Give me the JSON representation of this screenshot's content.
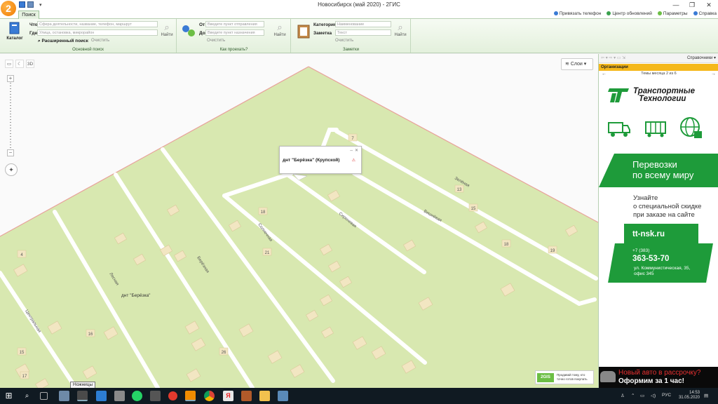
{
  "app": {
    "logo": "2",
    "title": "Новосибирск (май 2020) - 2ГИС",
    "controls": [
      "—",
      "❐",
      "✕"
    ]
  },
  "ribbon": {
    "tab": "Поиск",
    "links": [
      "Привязать телефон",
      "Центр обновлений",
      "Параметры",
      "Справка"
    ],
    "search": {
      "catalog": "Каталог",
      "what_label": "Что",
      "what_placeholder": "Сфера деятельности, название, телефон, маршрут",
      "where_label": "Где",
      "where_placeholder": "Улица, остановка, микрорайон",
      "advanced": "Расширенный поиск",
      "clear": "Очистить",
      "find": "Найти",
      "group": "Основной поиск"
    },
    "route": {
      "from_label": "От",
      "from_placeholder": "Введите пункт отправления",
      "to_label": "До",
      "to_placeholder": "Введите пункт назначения",
      "clear": "Очистить",
      "find": "Найти",
      "group": "Как проехать?"
    },
    "notes": {
      "category_label": "Категория",
      "category_placeholder": "Наименование",
      "note_label": "Заметка",
      "note_placeholder": "Текст",
      "clear": "Очистить",
      "find": "Найти",
      "group": "Заметки"
    }
  },
  "map": {
    "tools": [
      "▭",
      "☾",
      "3D"
    ],
    "zoom_in": "+",
    "zoom_out": "−",
    "compass": "✦",
    "layers": "Слои",
    "popup_title": "днт \"Берёзка\" (Крупской)",
    "popup_controls": "⇔ ✕",
    "popup_warn": "⚠",
    "district_label": "днт \"Берёзка\"",
    "streets": [
      "Лесная",
      "Центральная",
      "Берёзная",
      "Солнечная",
      "Сиреневая",
      "Вишнёвая",
      "Зелёная"
    ],
    "house_numbers": [
      "7",
      "13",
      "15",
      "18",
      "18",
      "19",
      "21",
      "4",
      "16",
      "26",
      "15",
      "17"
    ],
    "gis_ad_logo": "2GIS",
    "gis_ad_text": [
      "Продавай тому, кто",
      "точно готов покупать"
    ],
    "tooltip": "Ножницы"
  },
  "panel": {
    "nav_dropdown": "Справочники",
    "section": "Организации",
    "month_topics": "Темы месяца 2 из 6",
    "ad": {
      "brand_line1": "Транспортные",
      "brand_line2": "Технологии",
      "slogan_line1": "Перевозки",
      "slogan_line2": "по всему миру",
      "discount_line1": "Узнайте",
      "discount_line2": "о специальной скидке",
      "discount_line3": "при заказе на сайте",
      "url": "tt-nsk.ru",
      "phone_label": "+7 (383)",
      "phone": "363-53-70",
      "address_line1": "ул. Коммунистическая, 35,",
      "address_line2": "офис 345"
    },
    "car_ad_line1": "Новый авто в рассрочку?",
    "car_ad_line2": "Оформим за 1 час!"
  },
  "taskbar": {
    "lang": "РУС",
    "time": "14:53",
    "date": "31.05.2020"
  }
}
